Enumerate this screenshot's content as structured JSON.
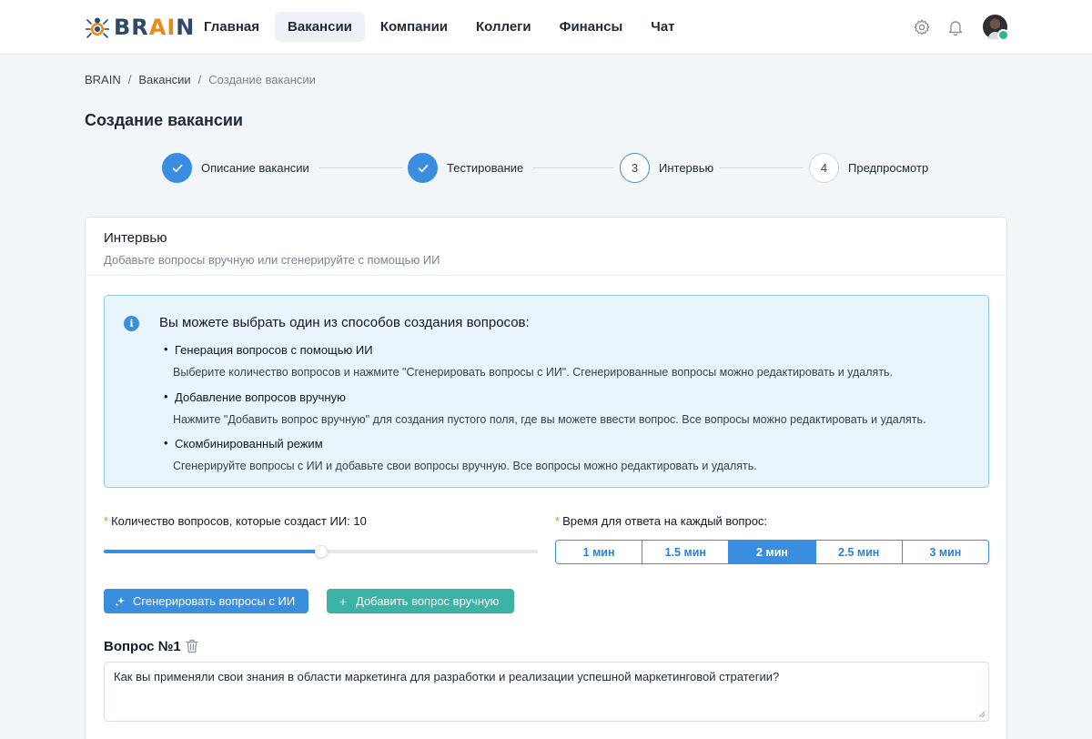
{
  "header": {
    "logo_text_pre": "BR",
    "logo_text_ai": "AI",
    "logo_text_post": "N",
    "nav": [
      {
        "label": "Главная",
        "active": false
      },
      {
        "label": "Вакансии",
        "active": true
      },
      {
        "label": "Компании",
        "active": false
      },
      {
        "label": "Коллеги",
        "active": false
      },
      {
        "label": "Финансы",
        "active": false
      },
      {
        "label": "Чат",
        "active": false
      }
    ],
    "icons": [
      "gear-icon",
      "bell-icon",
      "avatar"
    ],
    "online_status_color": "#35b38f"
  },
  "breadcrumb": [
    "BRAIN",
    "Вакансии",
    "Создание вакансии"
  ],
  "breadcrumb_sep": "/",
  "page_title": "Создание вакансии",
  "stepper": {
    "steps": [
      {
        "number": "1",
        "label": "Описание вакансии",
        "state": "done"
      },
      {
        "number": "2",
        "label": "Тестирование",
        "state": "done"
      },
      {
        "number": "3",
        "label": "Интервью",
        "state": "current"
      },
      {
        "number": "4",
        "label": "Предпросмотр",
        "state": "pending"
      }
    ]
  },
  "card": {
    "title": "Интервью",
    "subtitle": "Добавьте вопросы вручную или сгенерируйте с помощью ИИ"
  },
  "info": {
    "title": "Вы можете выбрать один из способов создания вопросов:",
    "items": [
      {
        "title": "Генерация вопросов с помощью ИИ",
        "desc": "Выберите количество вопросов и нажмите \"Сгенерировать вопросы с ИИ\". Сгенерированные вопросы можно редактировать и удалять."
      },
      {
        "title": "Добавление вопросов вручную",
        "desc": "Нажмите \"Добавить вопрос вручную\" для создания пустого поля, где вы можете ввести вопрос. Все вопросы можно редактировать и удалять."
      },
      {
        "title": "Скомбинированный режим",
        "desc": "Сгенерируйте вопросы с ИИ и добавьте свои вопросы вручную. Все вопросы можно редактировать и удалять."
      }
    ]
  },
  "question_count": {
    "required_mark": "*",
    "label": "Количество вопросов, которые создаст ИИ: 10",
    "slider_value": 10,
    "slider_fraction": 0.5
  },
  "answer_time": {
    "required_mark": "*",
    "label": "Время для ответа на каждый вопрос:",
    "options": [
      "1 мин",
      "1.5 мин",
      "2 мин",
      "2.5 мин",
      "3 мин"
    ],
    "selected": "2 мин"
  },
  "buttons": {
    "generate": "Сгенерировать вопросы с ИИ",
    "add_manual": "Добавить вопрос вручную",
    "add_icon": "+"
  },
  "question": {
    "title": "Вопрос №1",
    "text": "Как вы применяли свои знания в области маркетинга для разработки и реализации успешной маркетинговой стратегии?"
  },
  "colors": {
    "accent": "#3a8ee0",
    "teal": "#3ab2a4",
    "orange": "#e8891b",
    "info_bg": "#e9f5fc"
  }
}
